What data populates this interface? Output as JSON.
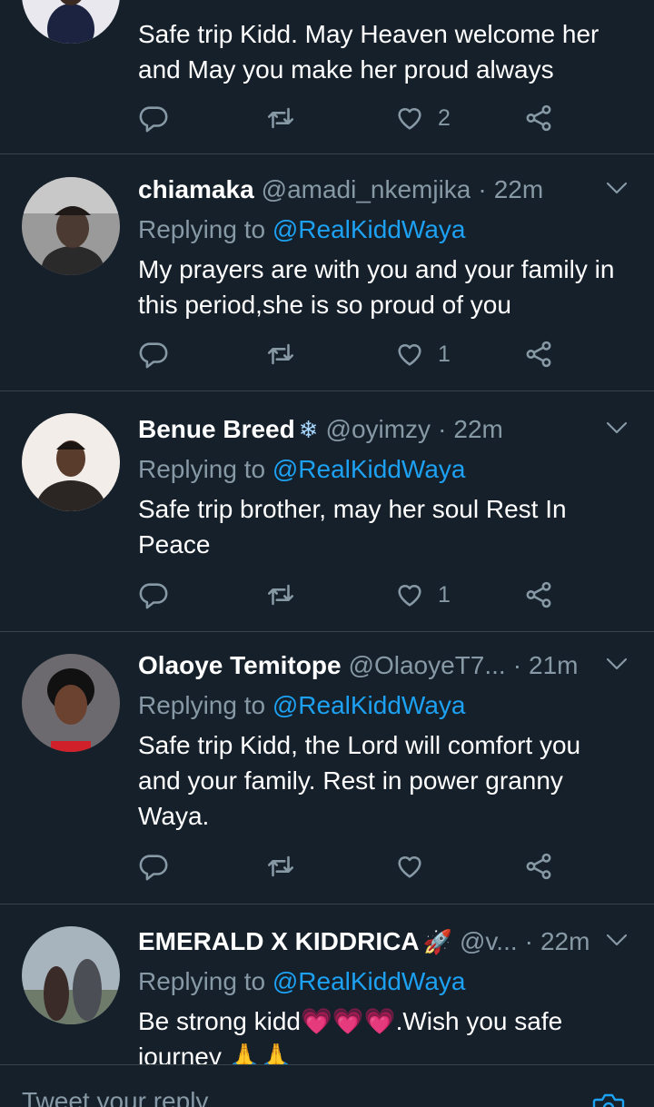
{
  "tweets": [
    {
      "text": "Safe trip Kidd. May Heaven welcome her and May you make her proud always",
      "like_count": "2"
    },
    {
      "name": "chiamaka",
      "handle": "@amadi_nkemjika",
      "time": "22m",
      "replying_prefix": "Replying to",
      "replying_to": "@RealKiddWaya",
      "text": "My prayers are with you and your family in this period,she is so proud of you",
      "like_count": "1"
    },
    {
      "name": "Benue Breed",
      "name_emoji": "❄",
      "handle": "@oyimzy",
      "time": "22m",
      "replying_prefix": "Replying to",
      "replying_to": "@RealKiddWaya",
      "text": "Safe trip brother, may her soul Rest In Peace",
      "like_count": "1"
    },
    {
      "name": "Olaoye Temitope",
      "handle": "@OlaoyeT7...",
      "time": "21m",
      "replying_prefix": "Replying to",
      "replying_to": "@RealKiddWaya",
      "text": "Safe trip Kidd, the Lord will comfort you and your family. Rest in power granny Waya.",
      "like_count": ""
    },
    {
      "name": "EMERALD X KIDDRICA",
      "name_emoji": "🚀",
      "handle": "@v...",
      "time": "22m",
      "replying_prefix": "Replying to",
      "replying_to": "@RealKiddWaya",
      "text": "Be strong kidd💗💗💗.Wish you safe journey 🙏🙏",
      "like_count": ""
    }
  ],
  "compose": {
    "placeholder": "Tweet your reply"
  },
  "icons": {
    "reply": "reply-icon",
    "retweet": "retweet-icon",
    "like": "heart-icon",
    "share": "share-icon",
    "more": "chevron-down-icon",
    "camera": "camera-icon"
  },
  "colors": {
    "background": "#15202b",
    "text_primary": "#ffffff",
    "text_secondary": "#8899a6",
    "accent": "#1da1f2",
    "divider": "#38444d"
  }
}
